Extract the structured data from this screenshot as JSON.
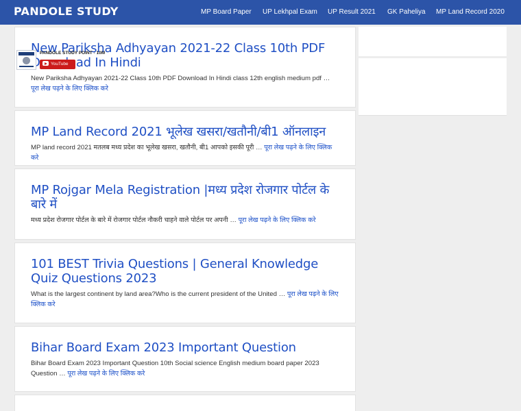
{
  "header": {
    "brand": "PANDOLE STUDY",
    "nav": [
      "MP Board Paper",
      "UP Lekhpal Exam",
      "UP Result 2021",
      "GK Paheliya",
      "MP Land Record 2020"
    ]
  },
  "posts": [
    {
      "title": "New Pariksha Adhyayan 2021-22 Class 10th PDF Download In Hindi",
      "excerpt": "New Pariksha Adhyayan 2021-22 Class 10th PDF Download In Hindi class 12th english medium pdf …",
      "read_more": "पूरा लेख पढ़ने के लिए क्लिक करे"
    },
    {
      "title": "MP Land Record 2021 भूलेख खसरा/खतौनी/बी1 ऑनलाइन",
      "excerpt": "MP land record 2021 मतलब मध्य प्रदेश का भूलेख खसरा, खतौनी, बी1 आपको इसकी पूरी …",
      "read_more": "पूरा लेख पढ़ने के लिए क्लिक करे"
    },
    {
      "title": "MP Rojgar Mela Registration |मध्य प्रदेश रोजगार पोर्टल के बारे में",
      "excerpt": "मध्य  प्रदेश रोजगार पोर्टल  के बारे में रोजगार पोर्टल नौकरी चाहने वाले पोर्टल पर अपनी …",
      "read_more": "पूरा लेख पढ़ने के लिए क्लिक करे"
    },
    {
      "title": "101 BEST Trivia Questions | General Knowledge Quiz Questions 2023",
      "excerpt": "What is the largest continent by land area?Who is the current president of the United …",
      "read_more": "पूरा लेख पढ़ने के लिए क्लिक करे"
    },
    {
      "title": "Bihar Board Exam 2023 Important Question",
      "excerpt": "Bihar Board Exam 2023 Important Question 10th Social science English medium board paper 2023 Question …",
      "read_more": "पूरा लेख पढ़ने के लिए क्लिक करे"
    }
  ],
  "sidebar": {
    "channel_name": "PANDOLE STUDY POINT - 10M",
    "subscribe_label": "YouTube"
  },
  "colors": {
    "header_bg": "#2c54a8",
    "title_link": "#1f4fc4",
    "youtube_red": "#cc1b1b"
  }
}
